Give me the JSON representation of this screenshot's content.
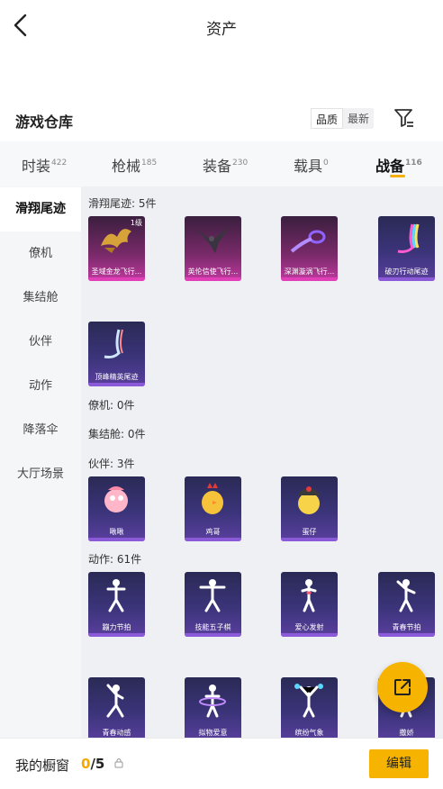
{
  "header": {
    "title": "资产",
    "back_icon": "chevron-left-icon"
  },
  "warehouse": {
    "title": "游戏仓库",
    "sort_options": [
      "品质",
      "最新"
    ],
    "filter_icon": "filter-icon"
  },
  "tabs": [
    {
      "label": "时装",
      "count": "422"
    },
    {
      "label": "枪械",
      "count": "185"
    },
    {
      "label": "装备",
      "count": "230"
    },
    {
      "label": "载具",
      "count": "0"
    },
    {
      "label": "战备",
      "count": "116"
    }
  ],
  "sidebar": [
    "滑翔尾迹",
    "僚机",
    "集结舱",
    "伙伴",
    "动作",
    "降落伞",
    "大厅场景"
  ],
  "sections": {
    "glide": {
      "title": "滑翔尾迹: 5件",
      "items": [
        "圣域金龙飞行...",
        "英伦信使飞行...",
        "深渊漩涡飞行...",
        "破刃行动尾迹",
        "顶峰精英尾迹"
      ],
      "level": "1级"
    },
    "wingman": {
      "title": "僚机: 0件"
    },
    "capsule": {
      "title": "集结舱: 0件"
    },
    "partner": {
      "title": "伙伴: 3件",
      "items": [
        "啾啾",
        "鸡哥",
        "蛋仔"
      ]
    },
    "action": {
      "title": "动作: 61件",
      "items": [
        "蹦力节拍",
        "技能五子棋",
        "爱心发射",
        "青春节拍",
        "青春动感",
        "拟物爱意",
        "缤纷气象",
        "撒娇"
      ]
    }
  },
  "bottom": {
    "label": "我的橱窗",
    "current": "0",
    "total": "/5",
    "edit_label": "编辑",
    "lock_icon": "lock-icon",
    "share_icon": "external-link-icon"
  },
  "colors": {
    "accent": "#f6b400",
    "card_purple": "#3b347a",
    "card_pink": "#c039a0"
  }
}
